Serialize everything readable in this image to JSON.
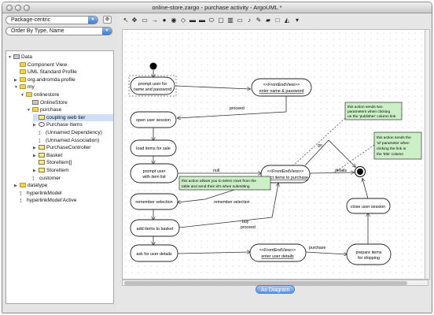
{
  "window": {
    "title": "online-store.zargo - purchase activity - ArgoUML *"
  },
  "explorer": {
    "perspective": "Package-centric",
    "order": "Order By Type, Name",
    "tree": [
      {
        "label": "Data",
        "icon": "model",
        "depth": 0,
        "tw": "▼"
      },
      {
        "label": "Component View",
        "icon": "folder",
        "depth": 1,
        "tw": ""
      },
      {
        "label": "UML Standard Profile",
        "icon": "folder",
        "depth": 1,
        "tw": ""
      },
      {
        "label": "org.andromda.profile",
        "icon": "folder",
        "depth": 1,
        "tw": "▶"
      },
      {
        "label": "my",
        "icon": "folder",
        "depth": 1,
        "tw": "▼"
      },
      {
        "label": "onlinestore",
        "icon": "folder",
        "depth": 2,
        "tw": "▼"
      },
      {
        "label": "OnlineStore",
        "icon": "model",
        "depth": 3,
        "tw": ""
      },
      {
        "label": "purchase",
        "icon": "folder",
        "depth": 3,
        "tw": "▼"
      },
      {
        "label": "coupling web tier",
        "icon": "cls",
        "depth": 4,
        "tw": "",
        "selected": true
      },
      {
        "label": "Purchase Items",
        "icon": "ell",
        "depth": 4,
        "tw": "▶"
      },
      {
        "label": "(Unnamed Dependency)",
        "icon": "pin",
        "depth": 4,
        "tw": ""
      },
      {
        "label": "(Unnamed Association)",
        "icon": "pin",
        "depth": 4,
        "tw": ""
      },
      {
        "label": "PurchaseController",
        "icon": "cls",
        "depth": 4,
        "tw": "▶"
      },
      {
        "label": "Basket",
        "icon": "cls",
        "depth": 4,
        "tw": "▶"
      },
      {
        "label": "StoreItem[]",
        "icon": "cls",
        "depth": 4,
        "tw": ""
      },
      {
        "label": "StoreItem",
        "icon": "cls",
        "depth": 4,
        "tw": "▶"
      },
      {
        "label": "customer",
        "icon": "pin",
        "depth": 3,
        "tw": ""
      },
      {
        "label": "datatype",
        "icon": "folder",
        "depth": 1,
        "tw": "▶"
      },
      {
        "label": "hyperlinkModel",
        "icon": "pin",
        "depth": 1,
        "tw": ""
      },
      {
        "label": "hyperlinkModel'Active",
        "icon": "pin",
        "depth": 1,
        "tw": ""
      }
    ]
  },
  "diagram": {
    "states": {
      "prompt_name": [
        "prompt user for",
        "name and password"
      ],
      "enter_name": [
        "<<FrontEndView>>",
        "enter name & password"
      ],
      "open_session": [
        "open user session"
      ],
      "load_items": [
        "load items for sale"
      ],
      "prompt_items": [
        "prompt user",
        "with item list"
      ],
      "select_items": [
        "<<FrontEndView>>",
        "select items to purchase"
      ],
      "remember": [
        "remember selection"
      ],
      "add_basket": [
        "add items to basket"
      ],
      "ask_details": [
        "ask for user details"
      ],
      "enter_details": [
        "<<FrontEndView>>",
        "enter user details"
      ],
      "prepare": [
        "prepare items",
        "for shipping"
      ],
      "close_session": [
        "close user session"
      ]
    },
    "transitions": {
      "proceed": "proceed",
      "null": "null",
      "remember": "remember selection",
      "buy": "buy",
      "proceed2": "proceed",
      "go": "go",
      "details": "details",
      "purchase": "purchase"
    },
    "notes": {
      "note1": [
        "this action sends two",
        "parameters when clicking",
        "on the 'publisher' column link"
      ],
      "note2": [
        "this action sends the",
        "'id' parameter when",
        "clicking the link in",
        "the 'title' column"
      ],
      "note3": [
        "this action allows you to select rows from the",
        "table and send their id's when submitting"
      ]
    }
  },
  "diagram_tab": {
    "label": "As Diagram"
  }
}
